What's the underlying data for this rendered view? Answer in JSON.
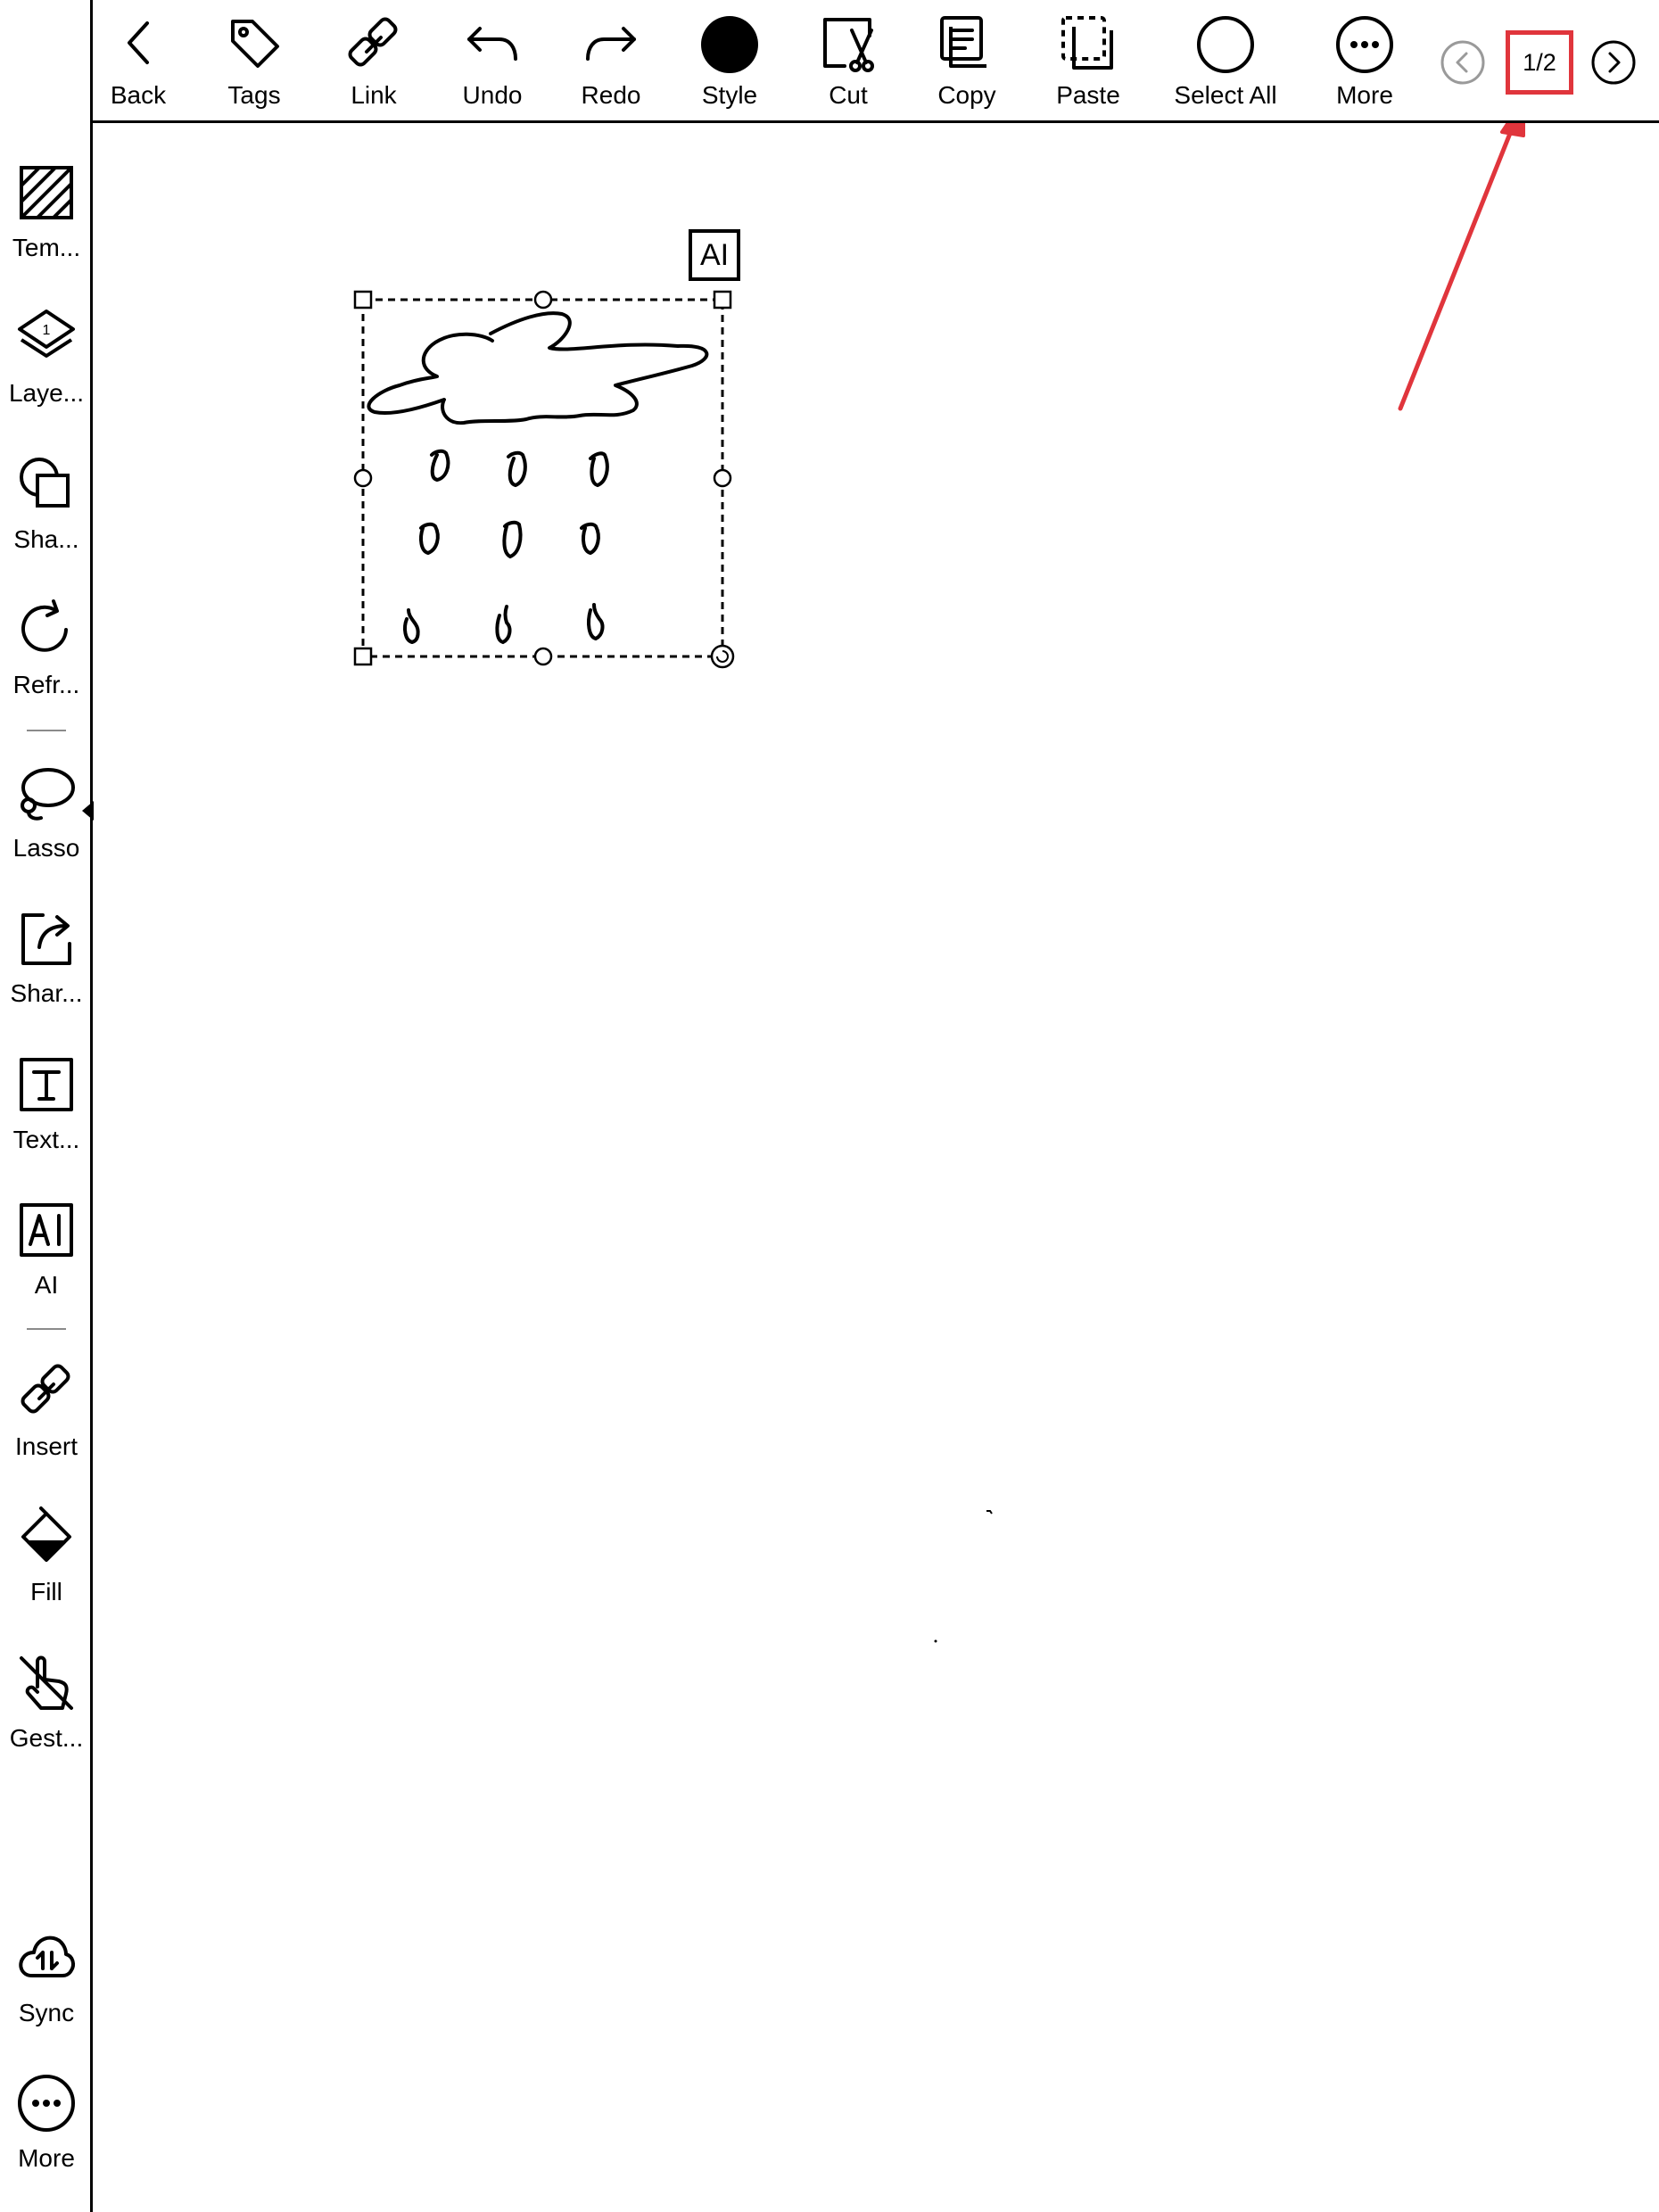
{
  "toolbar": {
    "back": "Back",
    "tags": "Tags",
    "link": "Link",
    "undo": "Undo",
    "redo": "Redo",
    "style": "Style",
    "cut": "Cut",
    "copy": "Copy",
    "paste": "Paste",
    "select_all": "Select All",
    "more": "More"
  },
  "pager": {
    "indicator": "1/2"
  },
  "sidebar": {
    "templates": "Tem...",
    "layers": "Laye...",
    "layer_count": "1",
    "shapes": "Sha...",
    "refresh": "Refr...",
    "lasso": "Lasso",
    "share": "Shar...",
    "text": "Text...",
    "ai": "AI",
    "insert": "Insert",
    "fill": "Fill",
    "gestures": "Gest...",
    "sync": "Sync",
    "more": "More"
  },
  "canvas": {
    "ai_badge": "AI"
  },
  "annotation": {
    "color": "#e0353c"
  }
}
